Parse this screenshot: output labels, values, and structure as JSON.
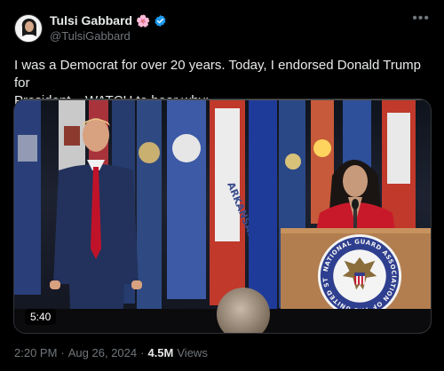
{
  "author": {
    "display_name": "Tulsi Gabbard",
    "name_emoji": "🌸",
    "handle": "@TulsiGabbard",
    "verified": true
  },
  "tweet": {
    "text": "I was a Democrat for over 20 years. Today, I endorsed Donald Trump for\nPresident.   WATCH to hear why:"
  },
  "media": {
    "type": "video",
    "duration": "5:40",
    "podium_seal_text": "NATIONAL GUARD ASSOCIATION OF THE UNITED STATES",
    "flag_text": "ARKANSAS"
  },
  "meta": {
    "time": "2:20 PM",
    "separator": "·",
    "date": "Aug 26, 2024",
    "views_count": "4.5M",
    "views_label": "Views"
  },
  "colors": {
    "background": "#000000",
    "text_primary": "#e7e9ea",
    "text_secondary": "#71767b",
    "verified_blue": "#1d9bf0"
  },
  "icons": {
    "verified": "verified-badge-icon",
    "more": "more-horizontal-icon"
  }
}
